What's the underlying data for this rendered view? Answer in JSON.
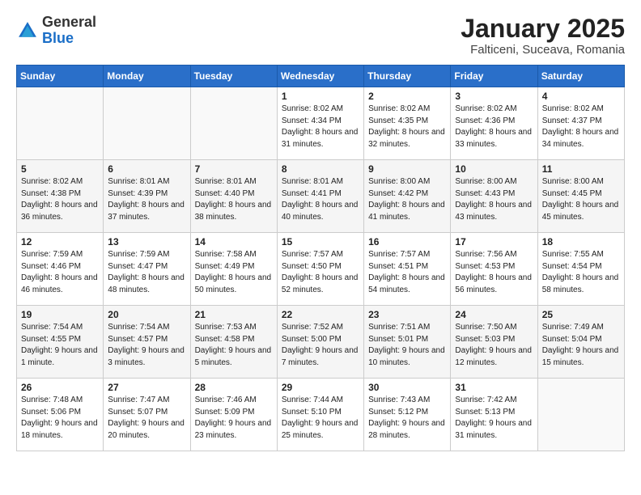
{
  "logo": {
    "general": "General",
    "blue": "Blue"
  },
  "title": "January 2025",
  "subtitle": "Falticeni, Suceava, Romania",
  "weekdays": [
    "Sunday",
    "Monday",
    "Tuesday",
    "Wednesday",
    "Thursday",
    "Friday",
    "Saturday"
  ],
  "weeks": [
    [
      {
        "day": "",
        "info": ""
      },
      {
        "day": "",
        "info": ""
      },
      {
        "day": "",
        "info": ""
      },
      {
        "day": "1",
        "info": "Sunrise: 8:02 AM\nSunset: 4:34 PM\nDaylight: 8 hours and 31 minutes."
      },
      {
        "day": "2",
        "info": "Sunrise: 8:02 AM\nSunset: 4:35 PM\nDaylight: 8 hours and 32 minutes."
      },
      {
        "day": "3",
        "info": "Sunrise: 8:02 AM\nSunset: 4:36 PM\nDaylight: 8 hours and 33 minutes."
      },
      {
        "day": "4",
        "info": "Sunrise: 8:02 AM\nSunset: 4:37 PM\nDaylight: 8 hours and 34 minutes."
      }
    ],
    [
      {
        "day": "5",
        "info": "Sunrise: 8:02 AM\nSunset: 4:38 PM\nDaylight: 8 hours and 36 minutes."
      },
      {
        "day": "6",
        "info": "Sunrise: 8:01 AM\nSunset: 4:39 PM\nDaylight: 8 hours and 37 minutes."
      },
      {
        "day": "7",
        "info": "Sunrise: 8:01 AM\nSunset: 4:40 PM\nDaylight: 8 hours and 38 minutes."
      },
      {
        "day": "8",
        "info": "Sunrise: 8:01 AM\nSunset: 4:41 PM\nDaylight: 8 hours and 40 minutes."
      },
      {
        "day": "9",
        "info": "Sunrise: 8:00 AM\nSunset: 4:42 PM\nDaylight: 8 hours and 41 minutes."
      },
      {
        "day": "10",
        "info": "Sunrise: 8:00 AM\nSunset: 4:43 PM\nDaylight: 8 hours and 43 minutes."
      },
      {
        "day": "11",
        "info": "Sunrise: 8:00 AM\nSunset: 4:45 PM\nDaylight: 8 hours and 45 minutes."
      }
    ],
    [
      {
        "day": "12",
        "info": "Sunrise: 7:59 AM\nSunset: 4:46 PM\nDaylight: 8 hours and 46 minutes."
      },
      {
        "day": "13",
        "info": "Sunrise: 7:59 AM\nSunset: 4:47 PM\nDaylight: 8 hours and 48 minutes."
      },
      {
        "day": "14",
        "info": "Sunrise: 7:58 AM\nSunset: 4:49 PM\nDaylight: 8 hours and 50 minutes."
      },
      {
        "day": "15",
        "info": "Sunrise: 7:57 AM\nSunset: 4:50 PM\nDaylight: 8 hours and 52 minutes."
      },
      {
        "day": "16",
        "info": "Sunrise: 7:57 AM\nSunset: 4:51 PM\nDaylight: 8 hours and 54 minutes."
      },
      {
        "day": "17",
        "info": "Sunrise: 7:56 AM\nSunset: 4:53 PM\nDaylight: 8 hours and 56 minutes."
      },
      {
        "day": "18",
        "info": "Sunrise: 7:55 AM\nSunset: 4:54 PM\nDaylight: 8 hours and 58 minutes."
      }
    ],
    [
      {
        "day": "19",
        "info": "Sunrise: 7:54 AM\nSunset: 4:55 PM\nDaylight: 9 hours and 1 minute."
      },
      {
        "day": "20",
        "info": "Sunrise: 7:54 AM\nSunset: 4:57 PM\nDaylight: 9 hours and 3 minutes."
      },
      {
        "day": "21",
        "info": "Sunrise: 7:53 AM\nSunset: 4:58 PM\nDaylight: 9 hours and 5 minutes."
      },
      {
        "day": "22",
        "info": "Sunrise: 7:52 AM\nSunset: 5:00 PM\nDaylight: 9 hours and 7 minutes."
      },
      {
        "day": "23",
        "info": "Sunrise: 7:51 AM\nSunset: 5:01 PM\nDaylight: 9 hours and 10 minutes."
      },
      {
        "day": "24",
        "info": "Sunrise: 7:50 AM\nSunset: 5:03 PM\nDaylight: 9 hours and 12 minutes."
      },
      {
        "day": "25",
        "info": "Sunrise: 7:49 AM\nSunset: 5:04 PM\nDaylight: 9 hours and 15 minutes."
      }
    ],
    [
      {
        "day": "26",
        "info": "Sunrise: 7:48 AM\nSunset: 5:06 PM\nDaylight: 9 hours and 18 minutes."
      },
      {
        "day": "27",
        "info": "Sunrise: 7:47 AM\nSunset: 5:07 PM\nDaylight: 9 hours and 20 minutes."
      },
      {
        "day": "28",
        "info": "Sunrise: 7:46 AM\nSunset: 5:09 PM\nDaylight: 9 hours and 23 minutes."
      },
      {
        "day": "29",
        "info": "Sunrise: 7:44 AM\nSunset: 5:10 PM\nDaylight: 9 hours and 25 minutes."
      },
      {
        "day": "30",
        "info": "Sunrise: 7:43 AM\nSunset: 5:12 PM\nDaylight: 9 hours and 28 minutes."
      },
      {
        "day": "31",
        "info": "Sunrise: 7:42 AM\nSunset: 5:13 PM\nDaylight: 9 hours and 31 minutes."
      },
      {
        "day": "",
        "info": ""
      }
    ]
  ]
}
